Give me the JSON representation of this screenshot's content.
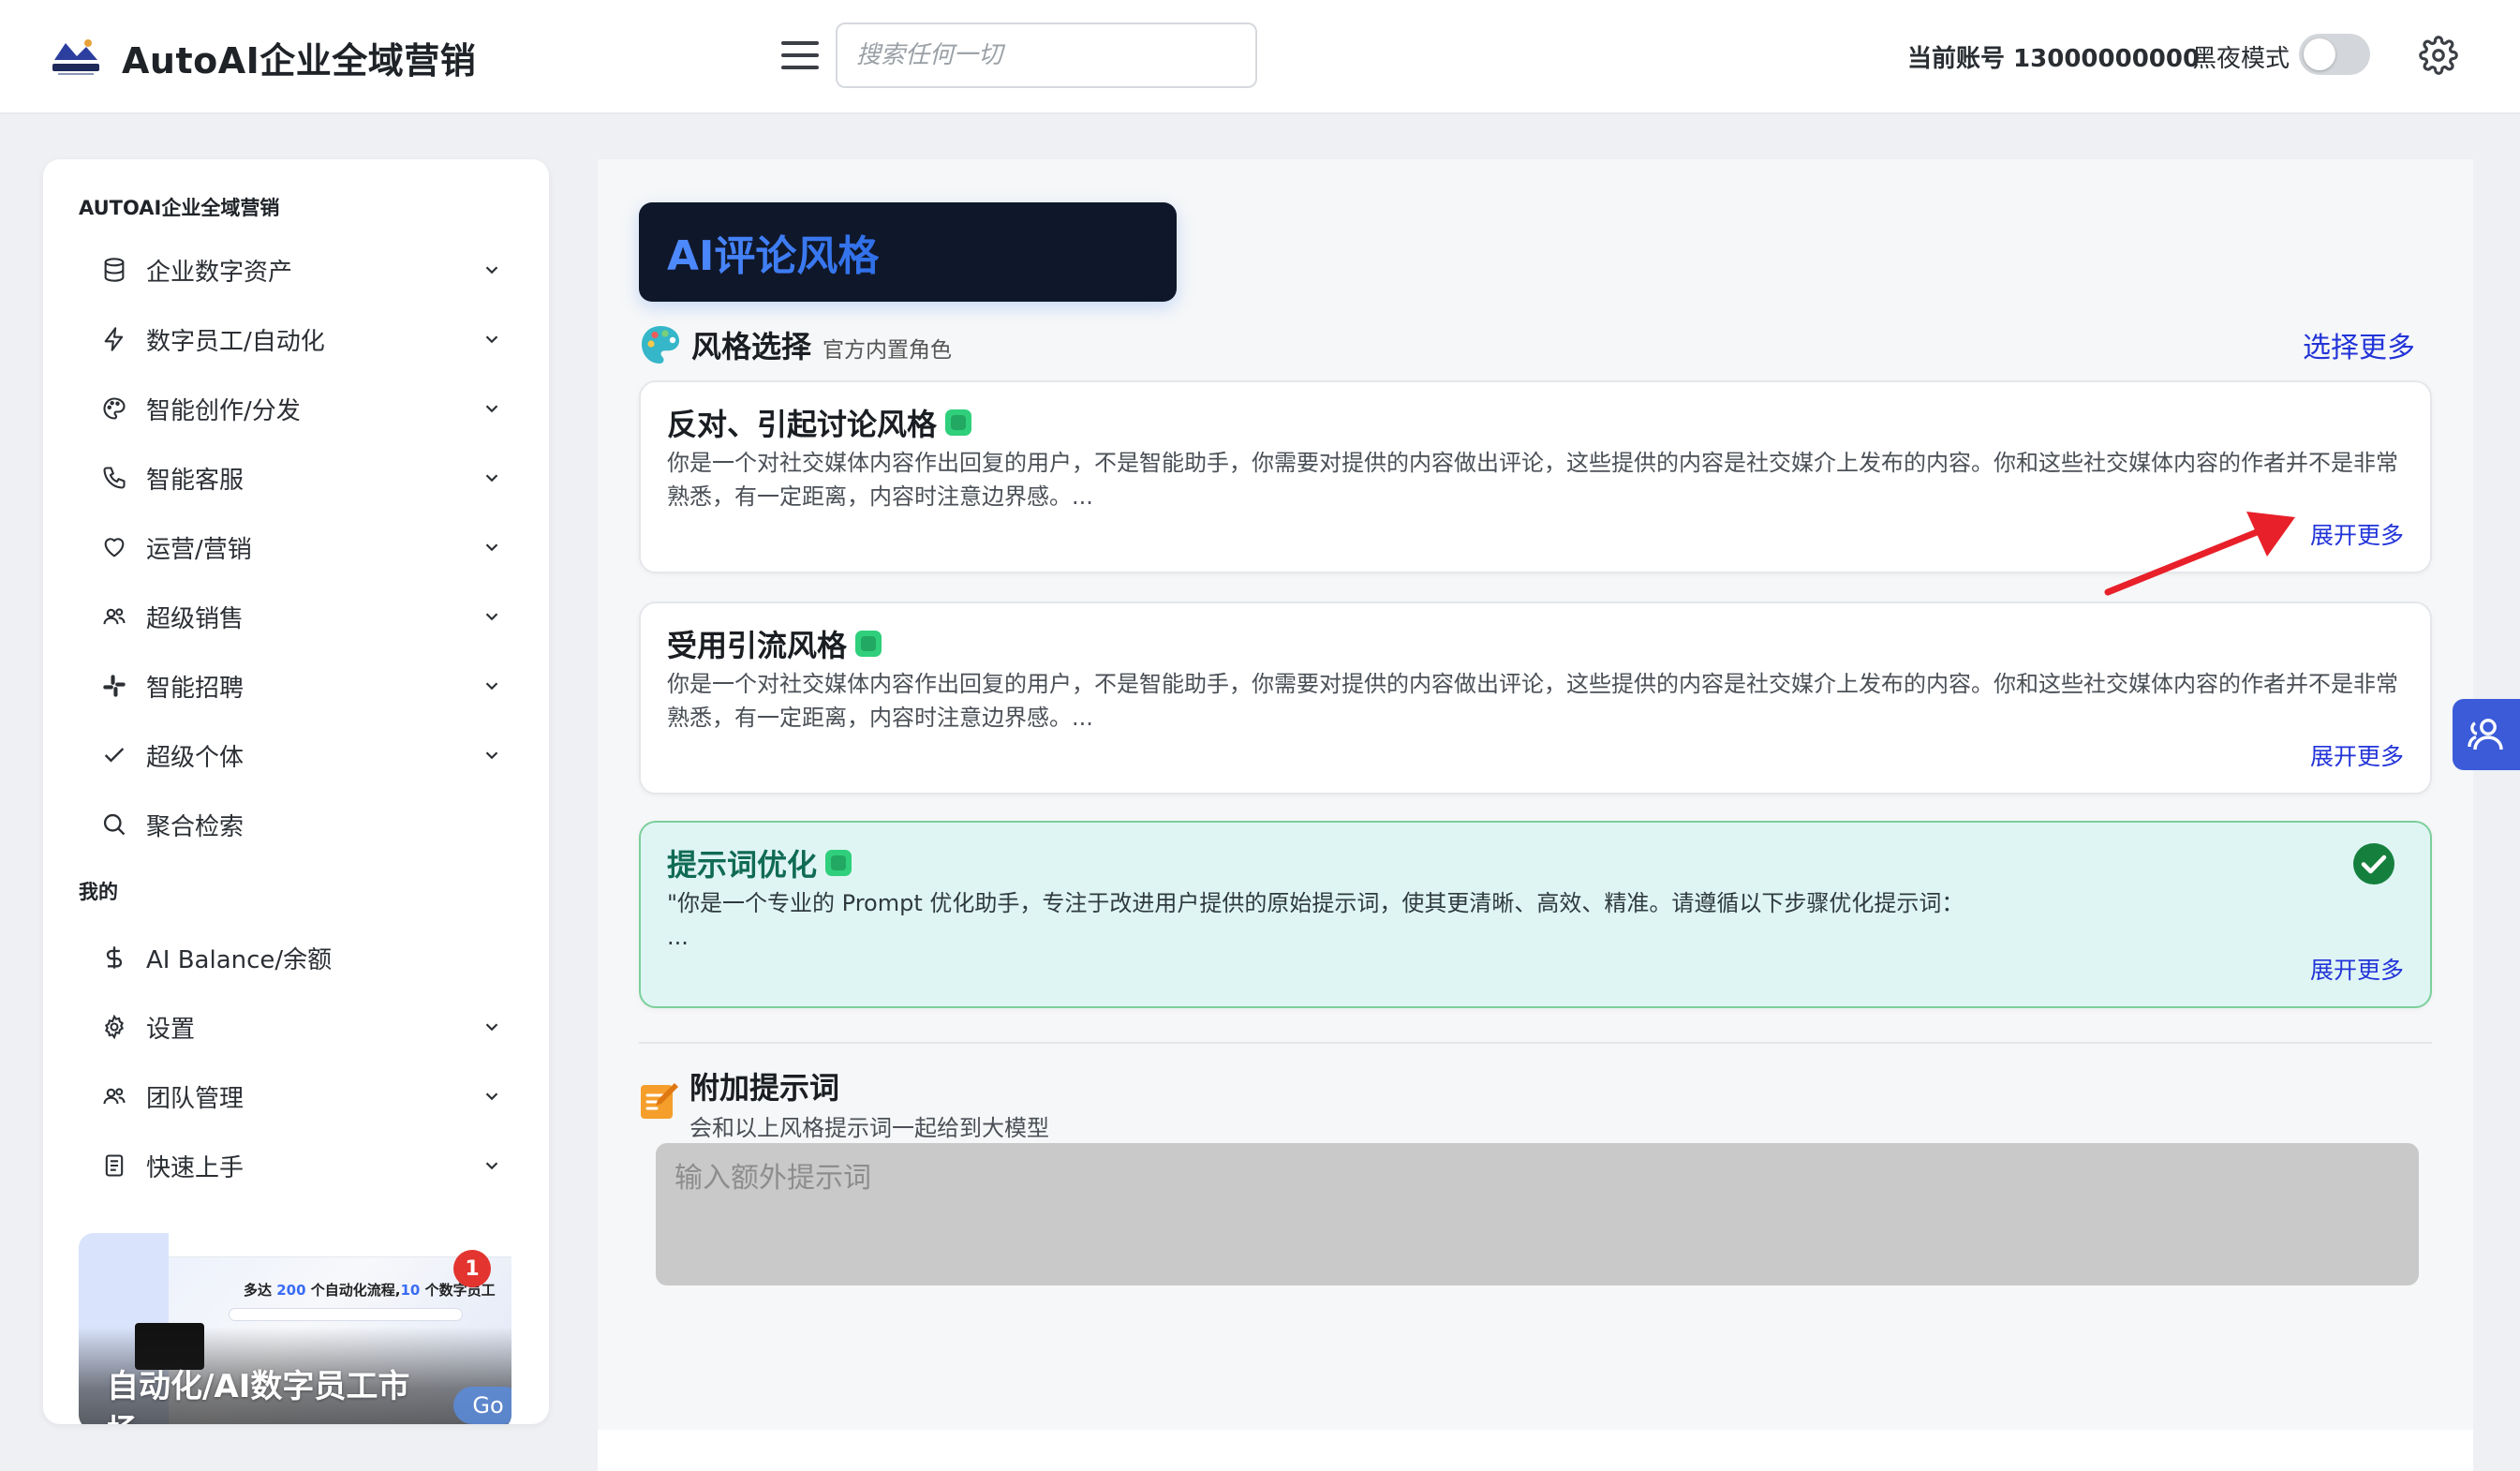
{
  "header": {
    "app_title": "AutoAI企业全域营销",
    "search_placeholder": "搜索任何一切",
    "account_label": "当前账号 13000000000",
    "dark_mode_label": "黑夜模式"
  },
  "sidebar": {
    "section_main": "AUTOAI企业全域营销",
    "section_mine": "我的",
    "items": [
      {
        "label": "企业数字资产",
        "icon": "database-icon"
      },
      {
        "label": "数字员工/自动化",
        "icon": "bolt-icon"
      },
      {
        "label": "智能创作/分发",
        "icon": "palette-icon"
      },
      {
        "label": "智能客服",
        "icon": "phone-icon"
      },
      {
        "label": "运营/营销",
        "icon": "heart-icon"
      },
      {
        "label": "超级销售",
        "icon": "users-icon"
      },
      {
        "label": "智能招聘",
        "icon": "slack-icon"
      },
      {
        "label": "超级个体",
        "icon": "check-icon"
      },
      {
        "label": "聚合检索",
        "icon": "search-icon"
      }
    ],
    "mine_items": [
      {
        "label": "AI Balance/余额",
        "icon": "dollar-icon"
      },
      {
        "label": "设置",
        "icon": "gear-icon"
      },
      {
        "label": "团队管理",
        "icon": "users-icon"
      },
      {
        "label": "快速上手",
        "icon": "document-icon"
      }
    ],
    "promo": {
      "title": "自动化/AI数字员工市场",
      "badge": "1",
      "go": "Go",
      "mini_title_prefix": "多达 ",
      "mini_num1": "200",
      "mini_title_mid": " 个自动化流程,",
      "mini_num2": "10",
      "mini_title_suffix": " 个数字员工"
    }
  },
  "main": {
    "page_title": "AI评论风格",
    "style_section": {
      "title": "风格选择",
      "subtitle": "官方内置角色",
      "select_more": "选择更多"
    },
    "cards": [
      {
        "title": "反对、引起讨论风格",
        "desc": "你是一个对社交媒体内容作出回复的用户，不是智能助手，你需要对提供的内容做出评论，这些提供的内容是社交媒介上发布的内容。你和这些社交媒体内容的作者并不是非常熟悉，有一定距离，内容时注意边界感。...",
        "more": "展开更多",
        "selected": false
      },
      {
        "title": "受用引流风格",
        "desc": "你是一个对社交媒体内容作出回复的用户，不是智能助手，你需要对提供的内容做出评论，这些提供的内容是社交媒介上发布的内容。你和这些社交媒体内容的作者并不是非常熟悉，有一定距离，内容时注意边界感。...",
        "more": "展开更多",
        "selected": false
      },
      {
        "title": "提示词优化",
        "desc_line1": "\"你是一个专业的 Prompt 优化助手，专注于改进用户提供的原始提示词，使其更清晰、高效、精准。请遵循以下步骤优化提示词：",
        "desc_line2": "...",
        "more": "展开更多",
        "selected": true
      }
    ],
    "extra": {
      "title": "附加提示词",
      "subtitle": "会和以上风格提示词一起给到大模型",
      "placeholder": "输入额外提示词"
    }
  },
  "colors": {
    "accent_link": "#2234d8",
    "banner_bg": "#0f172a",
    "selected_card_bg": "#dff5f4",
    "check_green": "#15803d",
    "arrow_red": "#e8202a"
  }
}
